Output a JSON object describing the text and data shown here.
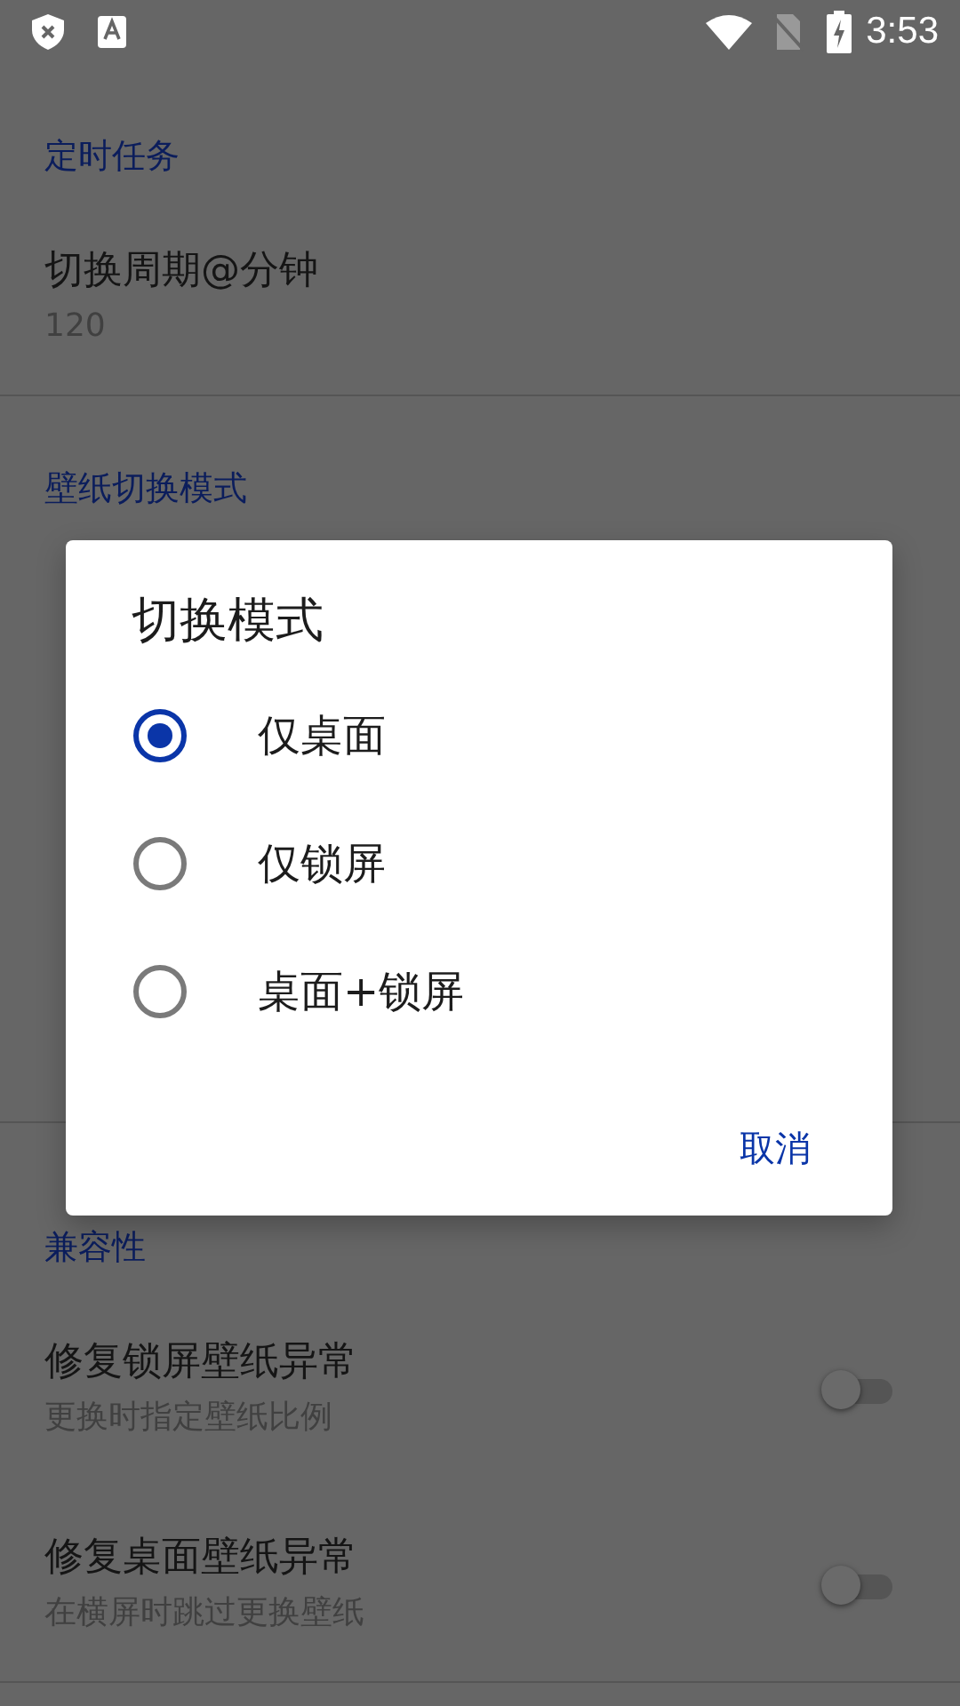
{
  "status_bar": {
    "time": "3:53"
  },
  "sections": [
    {
      "header": "定时任务",
      "items": [
        {
          "kind": "text",
          "title": "切换周期@分钟",
          "summary": "120"
        }
      ]
    },
    {
      "header": "壁纸切换模式"
    },
    {
      "header": "兼容性",
      "items": [
        {
          "kind": "switch",
          "title": "修复锁屏壁纸异常",
          "summary": "更换时指定壁纸比例",
          "on": false
        },
        {
          "kind": "switch",
          "title": "修复桌面壁纸异常",
          "summary": "在横屏时跳过更换壁纸",
          "on": false
        }
      ]
    }
  ],
  "dialog": {
    "title": "切换模式",
    "options": [
      {
        "label": "仅桌面",
        "selected": true
      },
      {
        "label": "仅锁屏",
        "selected": false
      },
      {
        "label": "桌面+锁屏",
        "selected": false
      }
    ],
    "buttons": [
      "取消"
    ]
  }
}
